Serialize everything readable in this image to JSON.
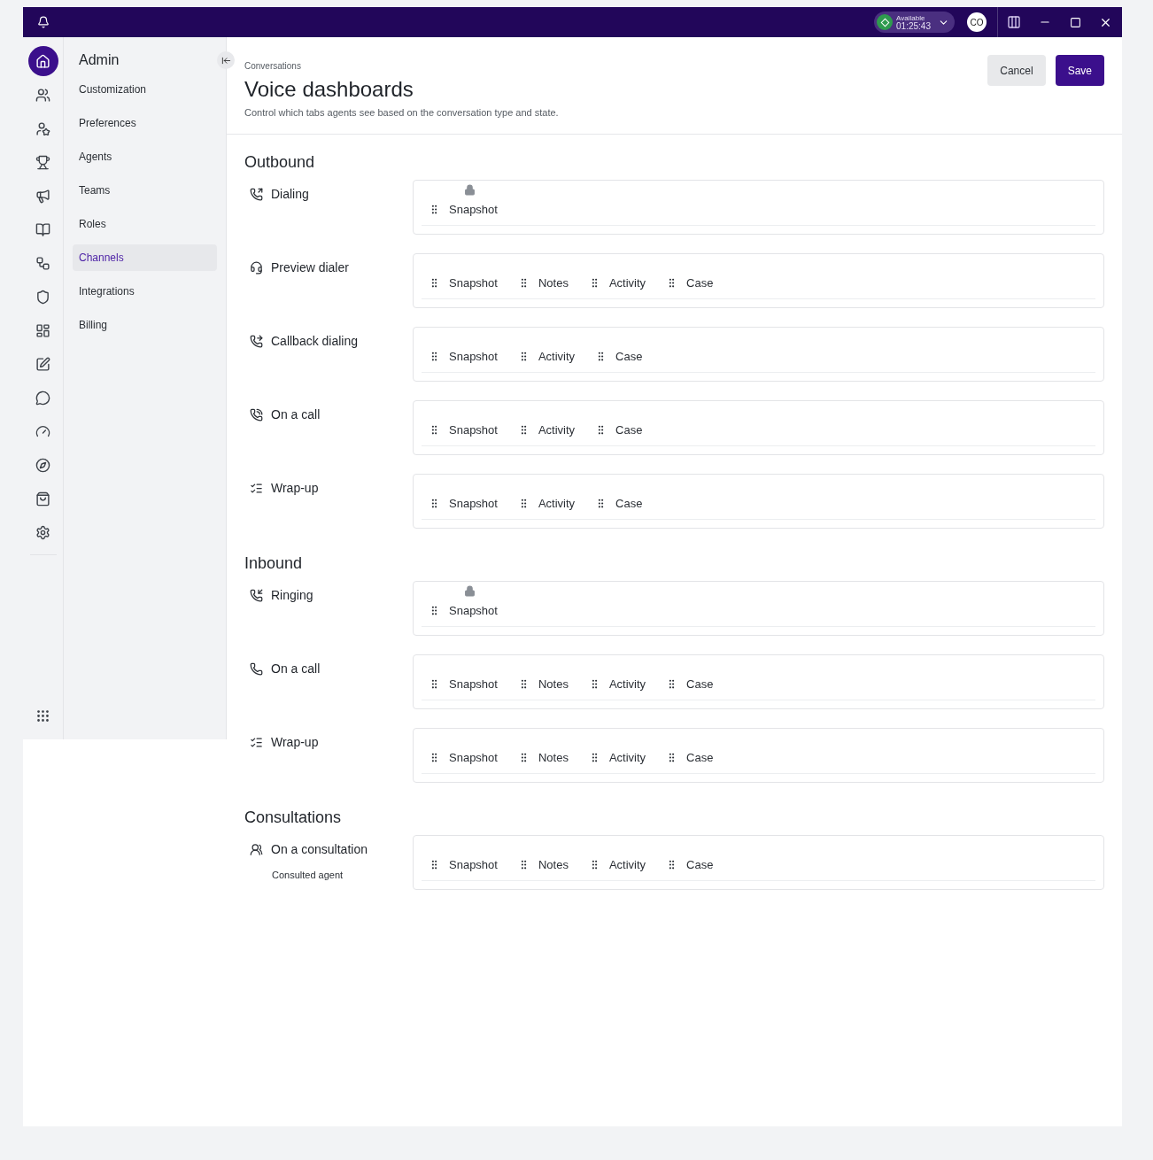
{
  "title_bar": {
    "status": {
      "label": "Available",
      "timer": "01:25:43"
    },
    "avatar": "CO"
  },
  "rail": [
    {
      "selected": true
    },
    {
      "selected": false
    },
    {
      "selected": false
    },
    {
      "selected": false
    },
    {
      "selected": false
    },
    {
      "selected": false
    },
    {
      "selected": false
    },
    {
      "selected": false
    },
    {
      "selected": false
    },
    {
      "selected": false
    },
    {
      "selected": false
    },
    {
      "selected": false
    },
    {
      "selected": false
    },
    {
      "selected": false
    },
    {
      "selected": false
    }
  ],
  "sidebar": {
    "title": "Admin",
    "items": [
      {
        "label": "Customization",
        "selected": false
      },
      {
        "label": "Preferences",
        "selected": false
      },
      {
        "label": "Agents",
        "selected": false
      },
      {
        "label": "Teams",
        "selected": false
      },
      {
        "label": "Roles",
        "selected": false
      },
      {
        "label": "Channels",
        "selected": true
      },
      {
        "label": "Integrations",
        "selected": false
      },
      {
        "label": "Billing",
        "selected": false
      }
    ]
  },
  "header": {
    "breadcrumb": "Conversations",
    "title": "Voice dashboards",
    "description": "Control which tabs agents see based on the conversation type and state.",
    "buttons": [
      "Cancel",
      "Save"
    ]
  },
  "sections": [
    {
      "title": "Outbound",
      "rows": [
        {
          "kind": "outgoing",
          "label": "Dialing",
          "tabs": [
            {
              "label": "Snapshot",
              "locked": true
            }
          ]
        },
        {
          "kind": "preview",
          "label": "Preview dialer",
          "tabs": [
            {
              "label": "Snapshot",
              "locked": false
            },
            {
              "label": "Notes",
              "locked": false
            },
            {
              "label": "Activity",
              "locked": false
            },
            {
              "label": "Case",
              "locked": false
            }
          ]
        },
        {
          "kind": "callback",
          "label": "Callback dialing",
          "tabs": [
            {
              "label": "Snapshot",
              "locked": false
            },
            {
              "label": "Activity",
              "locked": false
            },
            {
              "label": "Case",
              "locked": false
            }
          ]
        },
        {
          "kind": "active",
          "label": "On a call",
          "tabs": [
            {
              "label": "Snapshot",
              "locked": false
            },
            {
              "label": "Activity",
              "locked": false
            },
            {
              "label": "Case",
              "locked": false
            }
          ]
        },
        {
          "kind": "wrapup",
          "label": "Wrap-up",
          "tabs": [
            {
              "label": "Snapshot",
              "locked": false
            },
            {
              "label": "Activity",
              "locked": false
            },
            {
              "label": "Case",
              "locked": false
            }
          ]
        }
      ]
    },
    {
      "title": "Inbound",
      "rows": [
        {
          "kind": "incoming",
          "label": "Ringing",
          "tabs": [
            {
              "label": "Snapshot",
              "locked": true
            }
          ]
        },
        {
          "kind": "call",
          "label": "On a call",
          "tabs": [
            {
              "label": "Snapshot",
              "locked": false
            },
            {
              "label": "Notes",
              "locked": false
            },
            {
              "label": "Activity",
              "locked": false
            },
            {
              "label": "Case",
              "locked": false
            }
          ]
        },
        {
          "kind": "wrapup",
          "label": "Wrap-up",
          "tabs": [
            {
              "label": "Snapshot",
              "locked": false
            },
            {
              "label": "Notes",
              "locked": false
            },
            {
              "label": "Activity",
              "locked": false
            },
            {
              "label": "Case",
              "locked": false
            }
          ]
        }
      ]
    },
    {
      "title": "Consultations",
      "rows": [
        {
          "kind": "consultation",
          "label": "On a consultation",
          "sublabel": "Consulted agent",
          "tabs": [
            {
              "label": "Snapshot",
              "locked": false
            },
            {
              "label": "Notes",
              "locked": false
            },
            {
              "label": "Activity",
              "locked": false
            },
            {
              "label": "Case",
              "locked": false
            }
          ]
        }
      ]
    }
  ]
}
